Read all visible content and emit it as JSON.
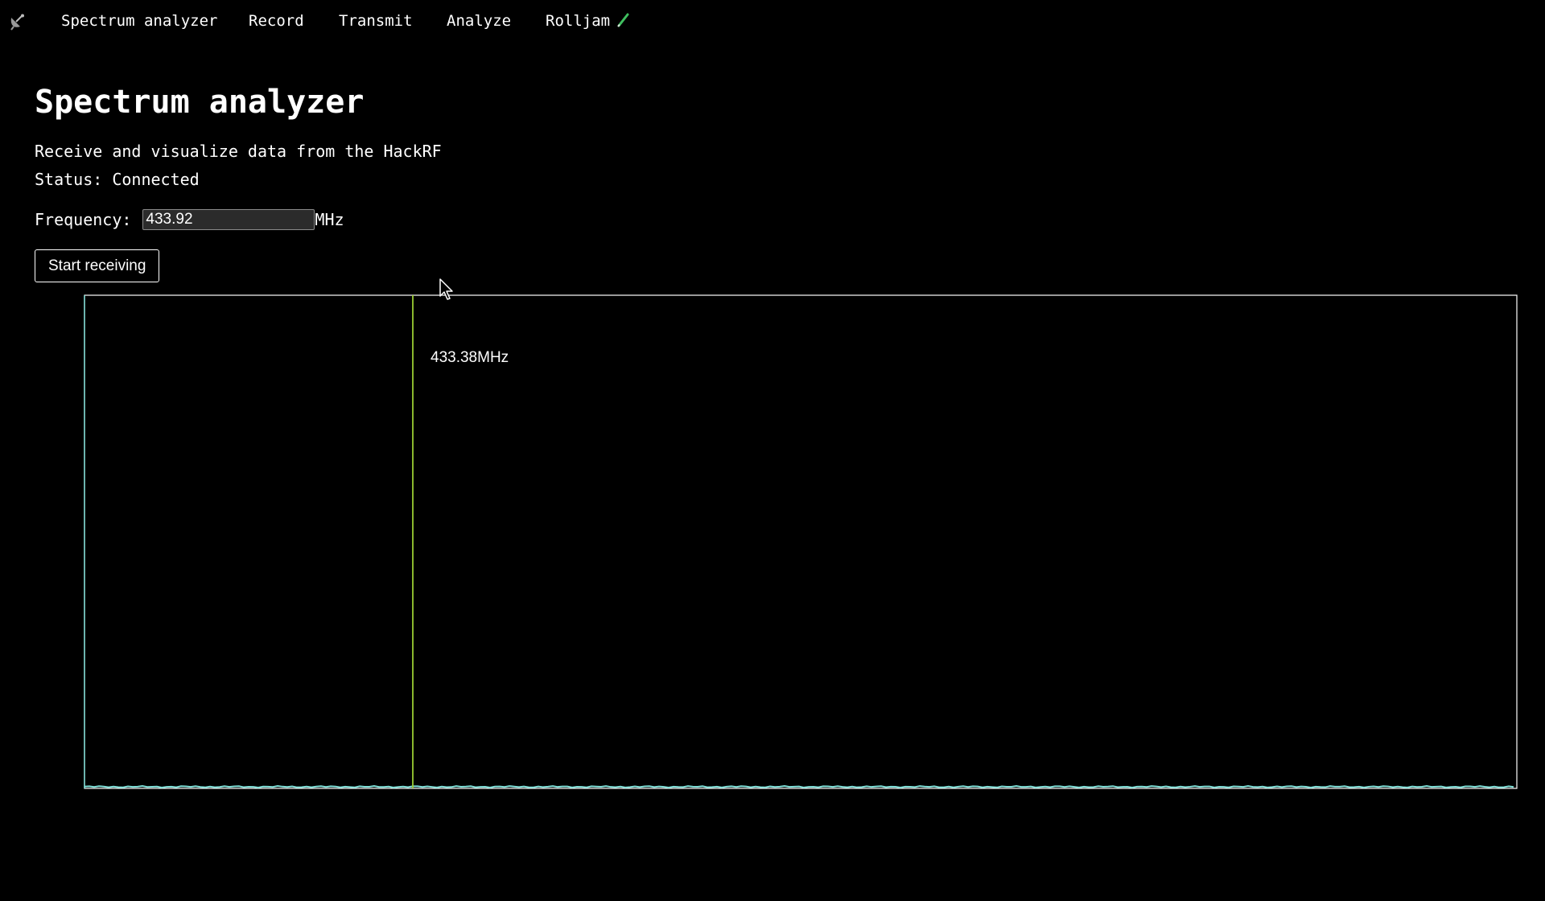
{
  "nav": {
    "logo_icon": "satellite-dish-icon",
    "items": [
      {
        "label": "Spectrum analyzer"
      },
      {
        "label": "Record"
      },
      {
        "label": "Transmit"
      },
      {
        "label": "Analyze"
      },
      {
        "label": "Rolljam",
        "icon": "pencil-icon"
      }
    ]
  },
  "page": {
    "title": "Spectrum analyzer",
    "subtitle": "Receive and visualize data from the HackRF",
    "status": "Status: Connected"
  },
  "frequency": {
    "label": "Frequency:",
    "value": "433.92",
    "unit": "MHz"
  },
  "controls": {
    "start_label": "Start receiving"
  },
  "spectrum": {
    "marker_label": "433.38MHz",
    "colors": {
      "frame": "#ffffff",
      "trace": "#7fe0d8",
      "marker": "#9acd32"
    }
  }
}
